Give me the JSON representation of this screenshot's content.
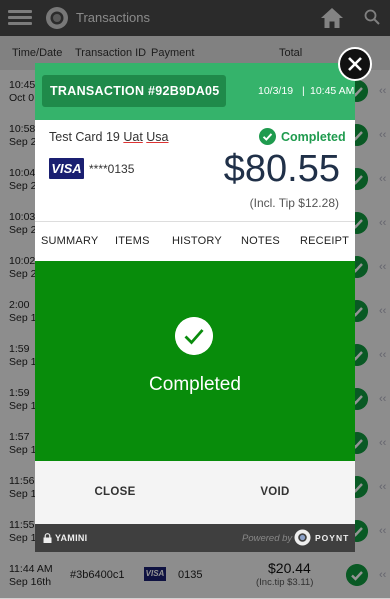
{
  "app": {
    "title": "Transactions"
  },
  "columns": [
    "Time/Date",
    "Transaction ID",
    "Payment",
    "Total"
  ],
  "background_rows": [
    {
      "time": "10:45",
      "date": "Oct 0"
    },
    {
      "time": "10:58",
      "date": "Sep 2"
    },
    {
      "time": "10:04",
      "date": "Sep 2"
    },
    {
      "time": "10:03",
      "date": "Sep 2"
    },
    {
      "time": "10:02",
      "date": "Sep 2"
    },
    {
      "time": "2:00",
      "date": "Sep 1"
    },
    {
      "time": "1:59",
      "date": "Sep 1"
    },
    {
      "time": "1:59",
      "date": "Sep 1"
    },
    {
      "time": "1:57",
      "date": "Sep 1"
    },
    {
      "time": "11:56",
      "date": "Sep 1"
    },
    {
      "time": "11:55",
      "date": "Sep 1"
    }
  ],
  "last_row": {
    "time": "11:44 AM",
    "date": "Sep 16th",
    "transaction_id": "#3b6400c1",
    "card_brand": "VISA",
    "last4": "0135",
    "total": "$20.44",
    "tip": "(Inc.tip $3.11)"
  },
  "modal": {
    "transaction_label": "TRANSACTION #92B9DA05",
    "date": "10/3/19",
    "separator": "|",
    "time": "10:45 AM",
    "card_prefix": "Test Card 19 ",
    "card_word1": "Uat",
    "card_word2": "Usa",
    "status": "Completed",
    "card_brand": "VISA",
    "masked_card": "****0135",
    "amount": "$80.55",
    "tip": "(Incl. Tip $12.28)",
    "tabs": [
      "SUMMARY",
      "ITEMS",
      "HISTORY",
      "NOTES",
      "RECEIPT"
    ],
    "status_big": "Completed",
    "close_label": "CLOSE",
    "void_label": "VOID",
    "user": "YAMINI",
    "powered_by": "Powered by",
    "brand": "POYNT"
  },
  "colors": {
    "header_green": "#35b36b",
    "transaction_badge": "#1f8a4a",
    "status_panel_green": "#088c0b",
    "amount_navy": "#203048",
    "footer": "#3f3f3f"
  },
  "icons": [
    "hamburger-icon",
    "app-logo-icon",
    "home-icon",
    "search-icon",
    "check-circle-icon",
    "close-icon",
    "lock-icon",
    "poynt-logo-icon",
    "visa-card-icon",
    "chevron-left-icon"
  ]
}
